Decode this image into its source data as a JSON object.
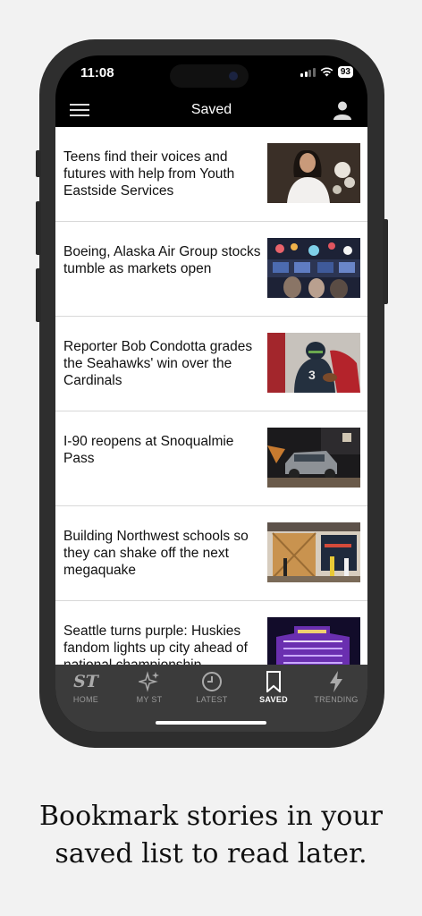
{
  "status_bar": {
    "time": "11:08",
    "battery": "93"
  },
  "header": {
    "title": "Saved"
  },
  "articles": [
    {
      "title": "Teens find their voices and futures with help from Youth Eastside Services"
    },
    {
      "title": "Boeing, Alaska Air Group stocks tumble as markets open"
    },
    {
      "title": "Reporter Bob Condotta grades the Seahawks' win over the Cardinals"
    },
    {
      "title": "I-90 reopens at Snoqualmie Pass"
    },
    {
      "title": "Building Northwest schools so they can shake off the next megaquake"
    },
    {
      "title": "Seattle turns purple: Huskies fandom lights up city ahead of national championship"
    }
  ],
  "tabs": [
    {
      "label": "HOME",
      "icon": "st-logo-icon"
    },
    {
      "label": "MY ST",
      "icon": "sparkle-icon"
    },
    {
      "label": "LATEST",
      "icon": "clock-icon"
    },
    {
      "label": "SAVED",
      "icon": "bookmark-icon"
    },
    {
      "label": "TRENDING",
      "icon": "lightning-icon"
    }
  ],
  "tab_logo_text": "ST",
  "caption": {
    "line1": "Bookmark stories in your",
    "line2": "saved list to read later."
  }
}
